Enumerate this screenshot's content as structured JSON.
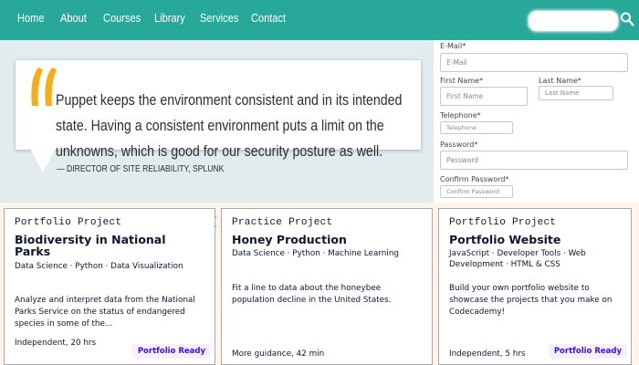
{
  "nav": {
    "items": [
      "Home",
      "About",
      "Courses",
      "Library",
      "Services",
      "Contact"
    ],
    "search": {
      "icon": "search-icon",
      "value": ""
    }
  },
  "testimonial": {
    "quote": "Puppet keeps the environment consistent and in its intended state. Having a consistent environment puts a limit on the unknowns, which is good for our security posture as well.",
    "attribution": "— DIRECTOR OF SITE RELIABILITY, SPLUNK",
    "quote_mark_color": "#f2ae1c"
  },
  "form": {
    "email": {
      "label": "E-Mail*",
      "placeholder": "E-Mail"
    },
    "first_name": {
      "label": "First Name*",
      "placeholder": "First Name"
    },
    "last_name": {
      "label": "Last Name*",
      "placeholder": "Last Name"
    },
    "telephone": {
      "label": "Telephone*",
      "placeholder": "Telephone"
    },
    "password": {
      "label": "Password*",
      "placeholder": "Password"
    },
    "confirm_password": {
      "label": "Confirm Password*",
      "placeholder": "Confirm Password"
    }
  },
  "cards": [
    {
      "kind": "Portfolio Project",
      "title": "Biodiversity in National Parks",
      "tags": "Data Science · Python · Data Visualization",
      "description": "Analyze and interpret data from the National Parks Service on the status of endangered species in some of the...",
      "meta": "Independent, 20 hrs",
      "badge": "Portfolio Ready"
    },
    {
      "kind": "Practice Project",
      "title": "Honey Production",
      "tags": "Data Science · Python · Machine Learning",
      "description": "Fit a line to data about the honeybee population decline in the United States.",
      "meta": "More guidance, 42 min",
      "badge": ""
    },
    {
      "kind": "Portfolio Project",
      "title": "Portfolio Website",
      "tags": "JavaScript · Developer Tools · Web Development · HTML & CSS",
      "description": "Build your own portfolio website to showcase the projects that you make on Codecademy!",
      "meta": "Independent, 5 hrs",
      "badge": "Portfolio Ready"
    }
  ],
  "colors": {
    "nav_bg": "#27a898",
    "band_bg": "#e2ecef",
    "cards_bg": "#fff4eb",
    "badge_text": "#3a10e5",
    "text_dark": "#10162f"
  }
}
